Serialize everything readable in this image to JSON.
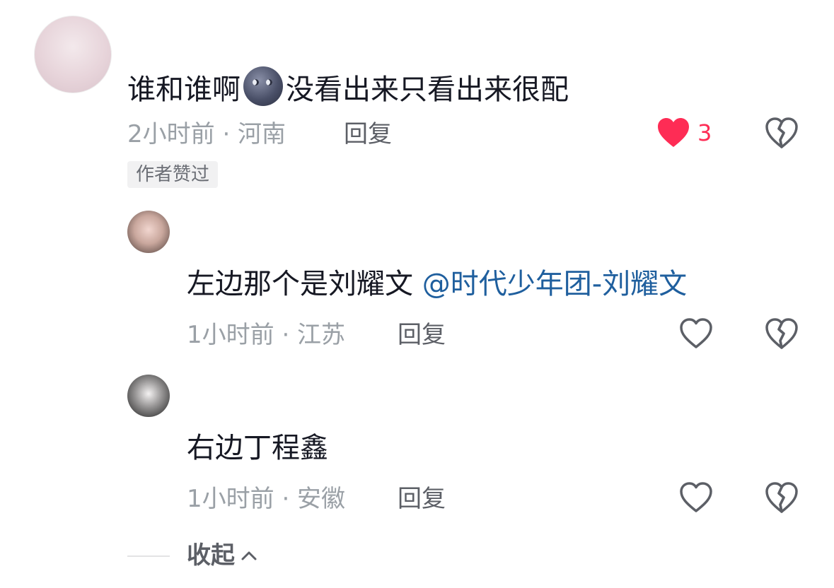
{
  "comment": {
    "text_before": "谁和谁啊",
    "emoji": "new-moon-face-emoji",
    "text_after": "没看出来只看出来很配",
    "time_location": "2小时前 · 河南",
    "reply_label": "回复",
    "like_count": "3",
    "liked": true,
    "badge": "作者赞过"
  },
  "replies": [
    {
      "text": "左边那个是刘耀文",
      "mention": "@时代少年团-刘耀文",
      "time_location": "1小时前 · 江苏",
      "reply_label": "回复"
    },
    {
      "text": "右边丁程鑫",
      "time_location": "1小时前 · 安徽",
      "reply_label": "回复"
    }
  ],
  "collapse_label": "收起",
  "colors": {
    "liked_heart": "#fe2c55",
    "mention": "#1f5f9e",
    "text": "#161823",
    "meta": "#9aa0a6"
  }
}
